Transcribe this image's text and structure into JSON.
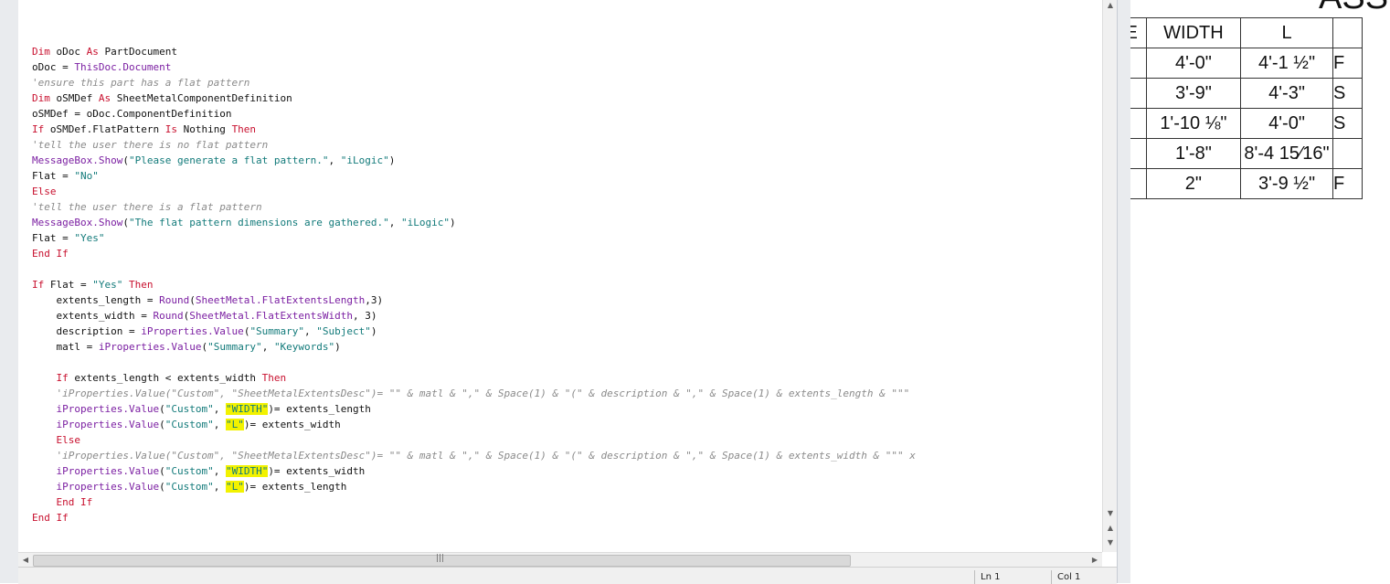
{
  "editor": {
    "status": {
      "line": "Ln 1",
      "column": "Col 1"
    },
    "code_lines": [
      [
        {
          "t": "Dim",
          "c": "kw"
        },
        {
          "t": " oDoc "
        },
        {
          "t": "As",
          "c": "kw"
        },
        {
          "t": " PartDocument"
        }
      ],
      [
        {
          "t": "oDoc = "
        },
        {
          "t": "ThisDoc.Document",
          "c": "fn"
        }
      ],
      [
        {
          "t": "'ensure this part has a flat pattern",
          "c": "cmt"
        }
      ],
      [
        {
          "t": "Dim",
          "c": "kw"
        },
        {
          "t": " oSMDef "
        },
        {
          "t": "As",
          "c": "kw"
        },
        {
          "t": " SheetMetalComponentDefinition"
        }
      ],
      [
        {
          "t": "oSMDef = oDoc.ComponentDefinition"
        }
      ],
      [
        {
          "t": "If",
          "c": "kw"
        },
        {
          "t": " oSMDef.FlatPattern "
        },
        {
          "t": "Is",
          "c": "kw"
        },
        {
          "t": " Nothing "
        },
        {
          "t": "Then",
          "c": "kw"
        }
      ],
      [
        {
          "t": "'tell the user there is no flat pattern",
          "c": "cmt"
        }
      ],
      [
        {
          "t": "MessageBox.Show",
          "c": "fn"
        },
        {
          "t": "("
        },
        {
          "t": "\"Please generate a flat pattern.\"",
          "c": "str"
        },
        {
          "t": ", "
        },
        {
          "t": "\"iLogic\"",
          "c": "str"
        },
        {
          "t": ")"
        }
      ],
      [
        {
          "t": "Flat = "
        },
        {
          "t": "\"No\"",
          "c": "str"
        }
      ],
      [
        {
          "t": "Else",
          "c": "kw"
        }
      ],
      [
        {
          "t": "'tell the user there is a flat pattern",
          "c": "cmt"
        }
      ],
      [
        {
          "t": "MessageBox.Show",
          "c": "fn"
        },
        {
          "t": "("
        },
        {
          "t": "\"The flat pattern dimensions are gathered.\"",
          "c": "str"
        },
        {
          "t": ", "
        },
        {
          "t": "\"iLogic\"",
          "c": "str"
        },
        {
          "t": ")"
        }
      ],
      [
        {
          "t": "Flat = "
        },
        {
          "t": "\"Yes\"",
          "c": "str"
        }
      ],
      [
        {
          "t": "End If",
          "c": "kw"
        }
      ],
      [],
      [
        {
          "t": "If",
          "c": "kw"
        },
        {
          "t": " Flat = "
        },
        {
          "t": "\"Yes\"",
          "c": "str"
        },
        {
          "t": " "
        },
        {
          "t": "Then",
          "c": "kw"
        }
      ],
      [
        {
          "t": "    extents_length = "
        },
        {
          "t": "Round",
          "c": "fn"
        },
        {
          "t": "("
        },
        {
          "t": "SheetMetal.FlatExtentsLength",
          "c": "fn"
        },
        {
          "t": ",3)"
        }
      ],
      [
        {
          "t": "    extents_width = "
        },
        {
          "t": "Round",
          "c": "fn"
        },
        {
          "t": "("
        },
        {
          "t": "SheetMetal.FlatExtentsWidth",
          "c": "fn"
        },
        {
          "t": ", 3)"
        }
      ],
      [
        {
          "t": "    description = "
        },
        {
          "t": "iProperties.Value",
          "c": "fn"
        },
        {
          "t": "("
        },
        {
          "t": "\"Summary\"",
          "c": "str"
        },
        {
          "t": ", "
        },
        {
          "t": "\"Subject\"",
          "c": "str"
        },
        {
          "t": ")"
        }
      ],
      [
        {
          "t": "    matl = "
        },
        {
          "t": "iProperties.Value",
          "c": "fn"
        },
        {
          "t": "("
        },
        {
          "t": "\"Summary\"",
          "c": "str"
        },
        {
          "t": ", "
        },
        {
          "t": "\"Keywords\"",
          "c": "str"
        },
        {
          "t": ")"
        }
      ],
      [],
      [
        {
          "t": "    "
        },
        {
          "t": "If",
          "c": "kw"
        },
        {
          "t": " extents_length < extents_width "
        },
        {
          "t": "Then",
          "c": "kw"
        }
      ],
      [
        {
          "t": "    'iProperties.Value(\"Custom\", \"SheetMetalExtentsDesc\")= \"\" & matl & \",\" & Space(1) & \"(\" & description & \",\" & Space(1) & extents_length & \"\"\" ",
          "c": "cmt"
        }
      ],
      [
        {
          "t": "    "
        },
        {
          "t": "iProperties.Value",
          "c": "fn"
        },
        {
          "t": "("
        },
        {
          "t": "\"Custom\"",
          "c": "str"
        },
        {
          "t": ", "
        },
        {
          "t": "\"WIDTH\"",
          "c": "str hl"
        },
        {
          "t": ")= extents_length"
        }
      ],
      [
        {
          "t": "    "
        },
        {
          "t": "iProperties.Value",
          "c": "fn"
        },
        {
          "t": "("
        },
        {
          "t": "\"Custom\"",
          "c": "str"
        },
        {
          "t": ", "
        },
        {
          "t": "\"L\"",
          "c": "str hl"
        },
        {
          "t": ")= extents_width"
        }
      ],
      [
        {
          "t": "    "
        },
        {
          "t": "Else",
          "c": "kw"
        }
      ],
      [
        {
          "t": "    'iProperties.Value(\"Custom\", \"SheetMetalExtentsDesc\")= \"\" & matl & \",\" & Space(1) & \"(\" & description & \",\" & Space(1) & extents_width & \"\"\" x",
          "c": "cmt"
        }
      ],
      [
        {
          "t": "    "
        },
        {
          "t": "iProperties.Value",
          "c": "fn"
        },
        {
          "t": "("
        },
        {
          "t": "\"Custom\"",
          "c": "str"
        },
        {
          "t": ", "
        },
        {
          "t": "\"WIDTH\"",
          "c": "str hl"
        },
        {
          "t": ")= extents_width"
        }
      ],
      [
        {
          "t": "    "
        },
        {
          "t": "iProperties.Value",
          "c": "fn"
        },
        {
          "t": "("
        },
        {
          "t": "\"Custom\"",
          "c": "str"
        },
        {
          "t": ", "
        },
        {
          "t": "\"L\"",
          "c": "str hl"
        },
        {
          "t": ")= extents_length"
        }
      ],
      [
        {
          "t": "    "
        },
        {
          "t": "End If",
          "c": "kw"
        }
      ],
      [
        {
          "t": "End If",
          "c": "kw"
        }
      ]
    ]
  },
  "drawing": {
    "title": "ASSE",
    "table": [
      [
        "DE",
        "WIDTH",
        "L",
        ""
      ],
      [
        ")",
        "4'-0\"",
        "4'-1 ½\"",
        "F"
      ],
      [
        "",
        "3'-9\"",
        "4'-3\"",
        "S"
      ],
      [
        "",
        "1'-10 ⅛\"",
        "4'-0\"",
        "S"
      ],
      [
        "",
        "1'-8\"",
        "8'-4 15⁄16\"",
        ""
      ],
      [
        ")",
        "2\"",
        "3'-9 ½\"",
        "F"
      ]
    ]
  }
}
